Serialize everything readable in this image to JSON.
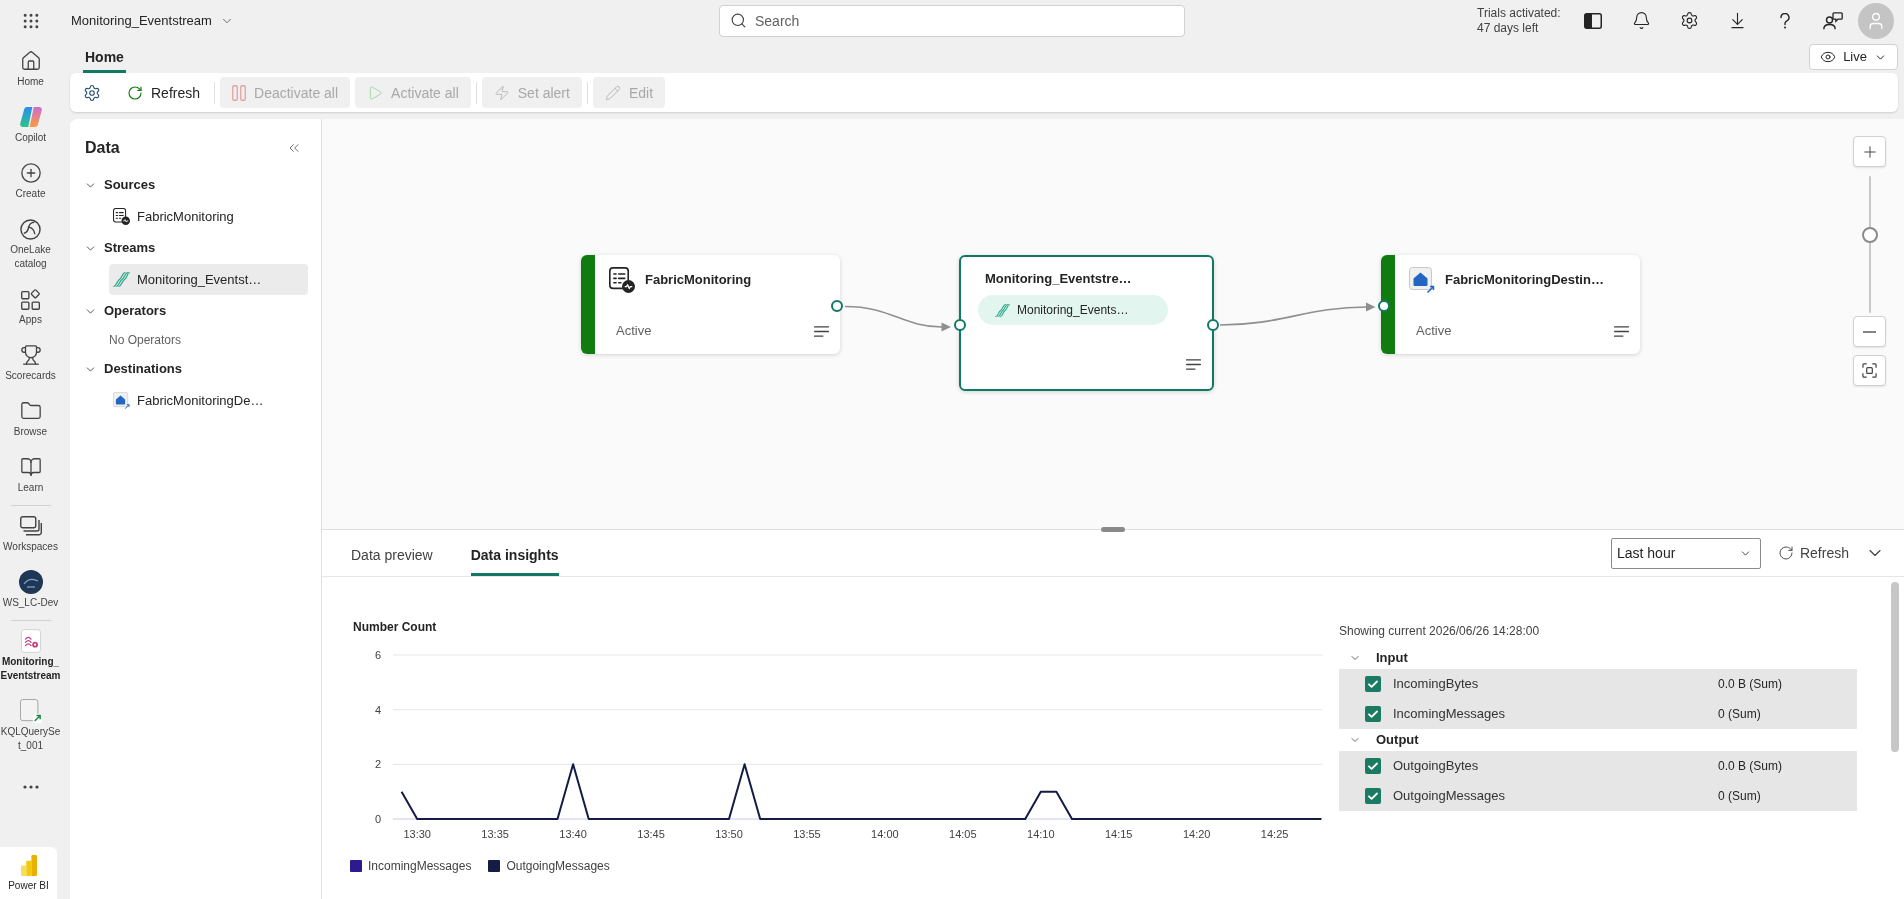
{
  "top_bar": {
    "app_title": "Monitoring_Eventstream",
    "search": {
      "placeholder": "Search"
    },
    "trial_status": "Trials activated: 47 days left"
  },
  "nav": {
    "sections": [
      {
        "items": [
          {
            "label": "Home",
            "selected": false
          },
          {
            "label": "Copilot",
            "selected": false
          },
          {
            "label": "Create",
            "selected": false
          },
          {
            "label": "OneLake catalog",
            "selected": false
          },
          {
            "label": "Apps",
            "selected": false
          },
          {
            "label": "Scorecards",
            "selected": false
          },
          {
            "label": "Browse",
            "selected": false
          },
          {
            "label": "Learn",
            "selected": false
          }
        ]
      },
      {
        "items": [
          {
            "label": "Workspaces",
            "selected": false
          },
          {
            "label": "WS_LC-Dev",
            "selected": false
          }
        ]
      },
      {
        "items": [
          {
            "label": "Monitoring_Eventstream",
            "selected": true
          },
          {
            "label": "KQLQuerySet_001",
            "selected": false
          }
        ]
      }
    ],
    "footer": {
      "label": "Power BI"
    }
  },
  "ribbon": {
    "tabs": [
      {
        "label": "Home",
        "selected": true
      }
    ],
    "view_mode": {
      "label": "Live"
    }
  },
  "toolbar": {
    "buttons": [
      {
        "label": "Refresh",
        "disabled": false
      },
      {
        "label": "Deactivate all",
        "disabled": true
      },
      {
        "label": "Activate all",
        "disabled": true
      },
      {
        "label": "Set alert",
        "disabled": true
      },
      {
        "label": "Edit",
        "disabled": true
      }
    ]
  },
  "data_panel": {
    "title": "Data",
    "groups": [
      {
        "label": "Sources",
        "expanded": true,
        "items": [
          {
            "kind": "source",
            "label": "FabricMonitoring",
            "selected": false
          }
        ]
      },
      {
        "label": "Streams",
        "expanded": true,
        "items": [
          {
            "kind": "stream",
            "label": "Monitoring_Eventst…",
            "selected": true
          }
        ]
      },
      {
        "label": "Operators",
        "expanded": true,
        "empty_text": "No Operators"
      },
      {
        "label": "Destinations",
        "expanded": true,
        "items": [
          {
            "kind": "destination",
            "label": "FabricMonitoringDe…",
            "selected": false
          }
        ]
      }
    ]
  },
  "canvas": {
    "nodes": [
      {
        "kind": "source",
        "title": "FabricMonitoring",
        "status": "Active",
        "selected": false
      },
      {
        "kind": "stream",
        "title": "Monitoring_Eventstre…",
        "chip": "Monitoring_Events…",
        "selected": true
      },
      {
        "kind": "destination",
        "title": "FabricMonitoringDestin…",
        "status": "Active",
        "selected": false
      }
    ],
    "zoom": {
      "level": 0.58
    }
  },
  "bottom_panel": {
    "tabs": [
      {
        "label": "Data preview",
        "selected": false
      },
      {
        "label": "Data insights",
        "selected": true
      }
    ],
    "time_range": {
      "value": "Last hour"
    },
    "refresh": {
      "label": "Refresh"
    },
    "chart_data": {
      "type": "line",
      "ylabel": "Number Count",
      "categories": [
        null,
        "13:30",
        null,
        null,
        null,
        null,
        "13:35",
        null,
        null,
        null,
        null,
        "13:40",
        null,
        null,
        null,
        null,
        "13:45",
        null,
        null,
        null,
        null,
        "13:50",
        null,
        null,
        null,
        null,
        "13:55",
        null,
        null,
        null,
        null,
        "14:00",
        null,
        null,
        null,
        null,
        "14:05",
        null,
        null,
        null,
        null,
        "14:10",
        null,
        null,
        null,
        null,
        "14:15",
        null,
        null,
        null,
        null,
        "14:20",
        null,
        null,
        null,
        null,
        "14:25",
        null,
        null,
        null
      ],
      "series": [
        {
          "name": "IncomingMessages",
          "color": "#2e1a8f",
          "values": [
            null,
            null,
            null,
            null,
            null,
            null,
            null,
            null,
            null,
            null,
            null,
            null,
            null,
            null,
            null,
            null,
            null,
            null,
            null,
            null,
            null,
            null,
            null,
            null,
            null,
            null,
            null,
            null,
            null,
            null,
            null,
            null,
            null,
            null,
            null,
            null,
            null,
            null,
            null,
            null,
            null,
            null,
            null,
            null,
            null,
            null,
            null,
            null,
            null,
            null,
            null,
            null,
            null,
            null,
            null,
            null,
            null,
            null,
            null,
            null
          ]
        },
        {
          "name": "OutgoingMessages",
          "color": "#141b44",
          "values": [
            1,
            0,
            0,
            0,
            0,
            0,
            0,
            0,
            0,
            0,
            0,
            2,
            0,
            0,
            0,
            0,
            0,
            0,
            0,
            0,
            0,
            0,
            2,
            0,
            0,
            0,
            0,
            0,
            0,
            0,
            0,
            0,
            0,
            0,
            0,
            0,
            0,
            0,
            0,
            0,
            0,
            1,
            1,
            0,
            0,
            0,
            0,
            0,
            0,
            0,
            0,
            0,
            0,
            0,
            0,
            0,
            0,
            0,
            0,
            0
          ]
        }
      ],
      "ylim": [
        0,
        6
      ],
      "yticks": [
        0,
        2,
        4,
        6
      ],
      "legend": "bottom"
    },
    "metrics": {
      "caption": "Showing current 2026/06/26 14:28:00",
      "groups": [
        {
          "label": "Input",
          "expanded": true,
          "rows": [
            {
              "label": "IncomingBytes",
              "value": "0.0 B (Sum)",
              "checked": true
            },
            {
              "label": "IncomingMessages",
              "value": "0 (Sum)",
              "checked": true
            }
          ]
        },
        {
          "label": "Output",
          "expanded": true,
          "rows": [
            {
              "label": "OutgoingBytes",
              "value": "0.0 B (Sum)",
              "checked": true
            },
            {
              "label": "OutgoingMessages",
              "value": "0 (Sum)",
              "checked": true
            }
          ]
        }
      ]
    }
  }
}
